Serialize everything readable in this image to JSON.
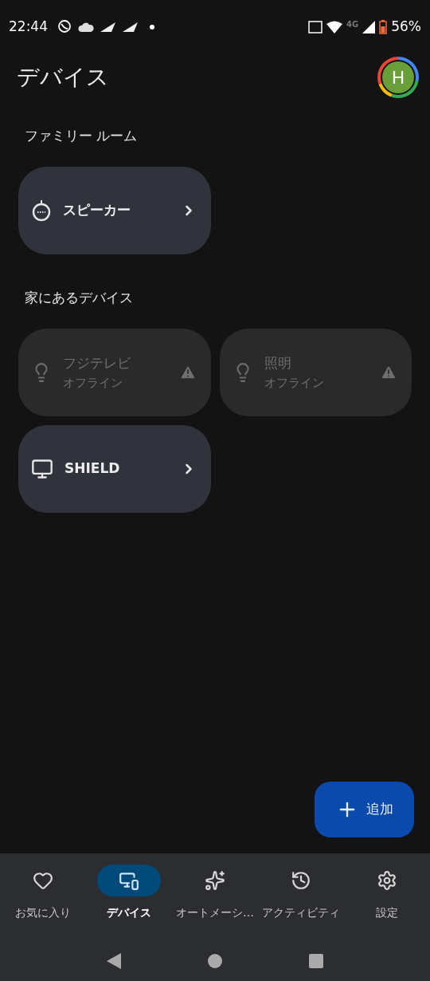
{
  "status_bar": {
    "time": "22:44",
    "battery": "56%",
    "network": "4G"
  },
  "header": {
    "title": "デバイス",
    "avatar": "H"
  },
  "sections": [
    {
      "title": "ファミリー ルーム",
      "devices": [
        {
          "kind": "speaker",
          "name": "スピーカー",
          "offline": false
        }
      ]
    },
    {
      "title": "家にあるデバイス",
      "devices": [
        {
          "kind": "bulb",
          "name": "フジテレビ",
          "offline": true,
          "status": "オフライン"
        },
        {
          "kind": "bulb",
          "name": "照明",
          "offline": true,
          "status": "オフライン"
        },
        {
          "kind": "tv",
          "name": "SHIELD",
          "offline": false
        }
      ]
    }
  ],
  "fab": {
    "label": "追加"
  },
  "nav": [
    {
      "kind": "favorites",
      "label": "お気に入り",
      "selected": false
    },
    {
      "kind": "devices",
      "label": "デバイス",
      "selected": true
    },
    {
      "kind": "automations",
      "label": "オートメーシ…",
      "selected": false
    },
    {
      "kind": "activity",
      "label": "アクティビティ",
      "selected": false
    },
    {
      "kind": "settings",
      "label": "設定",
      "selected": false
    }
  ]
}
